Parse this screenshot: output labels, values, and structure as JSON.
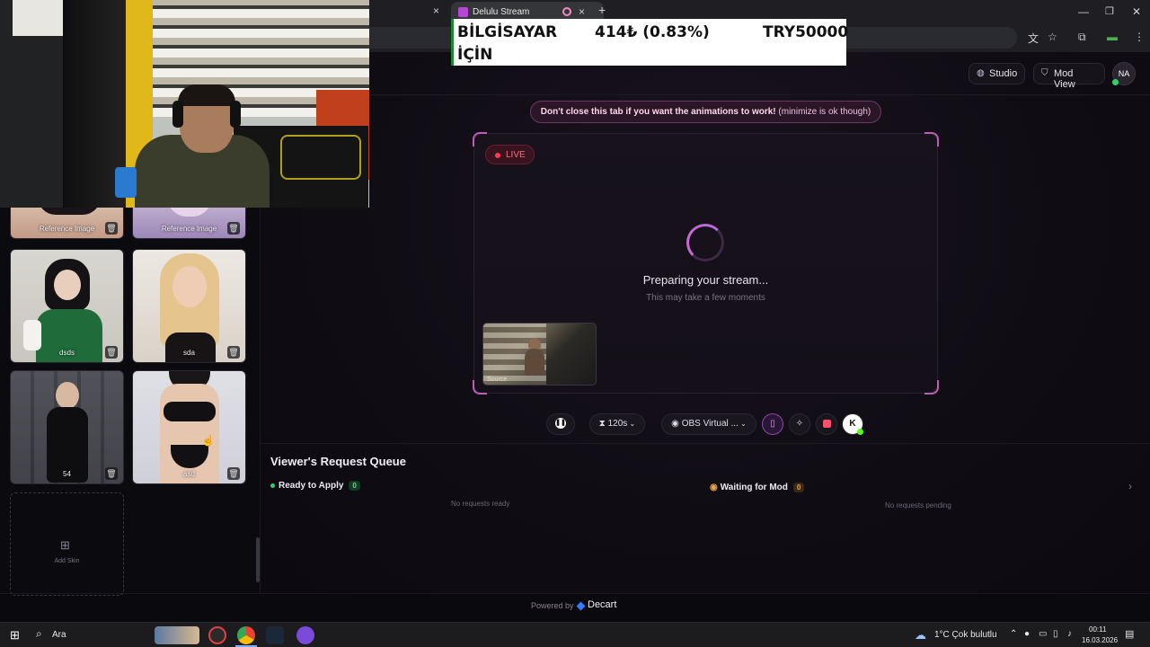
{
  "browser": {
    "tab_title": "Delulu Stream",
    "tab_close": "×",
    "new_tab": "+",
    "win_minimize": "—",
    "win_restore": "❐",
    "win_close": "✕"
  },
  "ticker": {
    "name_line1": "BİLGİSAYAR",
    "name_line2": "İÇİN",
    "amount": "414₺ (0.83%)",
    "goal": "TRY50000",
    "accent": "#1a8a2e"
  },
  "header": {
    "studio_label": "Studio",
    "mod_view_label": "Mod View",
    "avatar_initials": "NA"
  },
  "notice": {
    "bold_text": "Don't close this tab if you want the animations to work!",
    "light_text": "(minimize is ok though)"
  },
  "stream": {
    "live_label": "LIVE",
    "preparing_title": "Preparing your stream...",
    "preparing_sub": "This may take a few moments",
    "source_label": "Source"
  },
  "controls": {
    "timer_label": "120s",
    "camera_label": "OBS Virtual ...",
    "kick_label": "K"
  },
  "queue": {
    "title": "Viewer's Request Queue",
    "ready_label": "Ready to Apply",
    "ready_count": "0",
    "ready_empty": "No requests ready",
    "waiting_label": "Waiting for Mod",
    "waiting_count": "0",
    "waiting_empty": "No requests pending"
  },
  "footer": {
    "powered_by": "Powered by",
    "brand": "Decart"
  },
  "sidebar": {
    "skins": [
      {
        "name": "Reference Image"
      },
      {
        "name": "Reference Image"
      },
      {
        "name": "dsds"
      },
      {
        "name": "sda"
      },
      {
        "name": "54"
      },
      {
        "name": "asd"
      }
    ],
    "add_skin_label": "Add Skin"
  },
  "taskbar": {
    "search_placeholder": "Ara",
    "weather": "1°C  Çok bulutlu",
    "time": "00:11",
    "date": "16.03.2026"
  }
}
